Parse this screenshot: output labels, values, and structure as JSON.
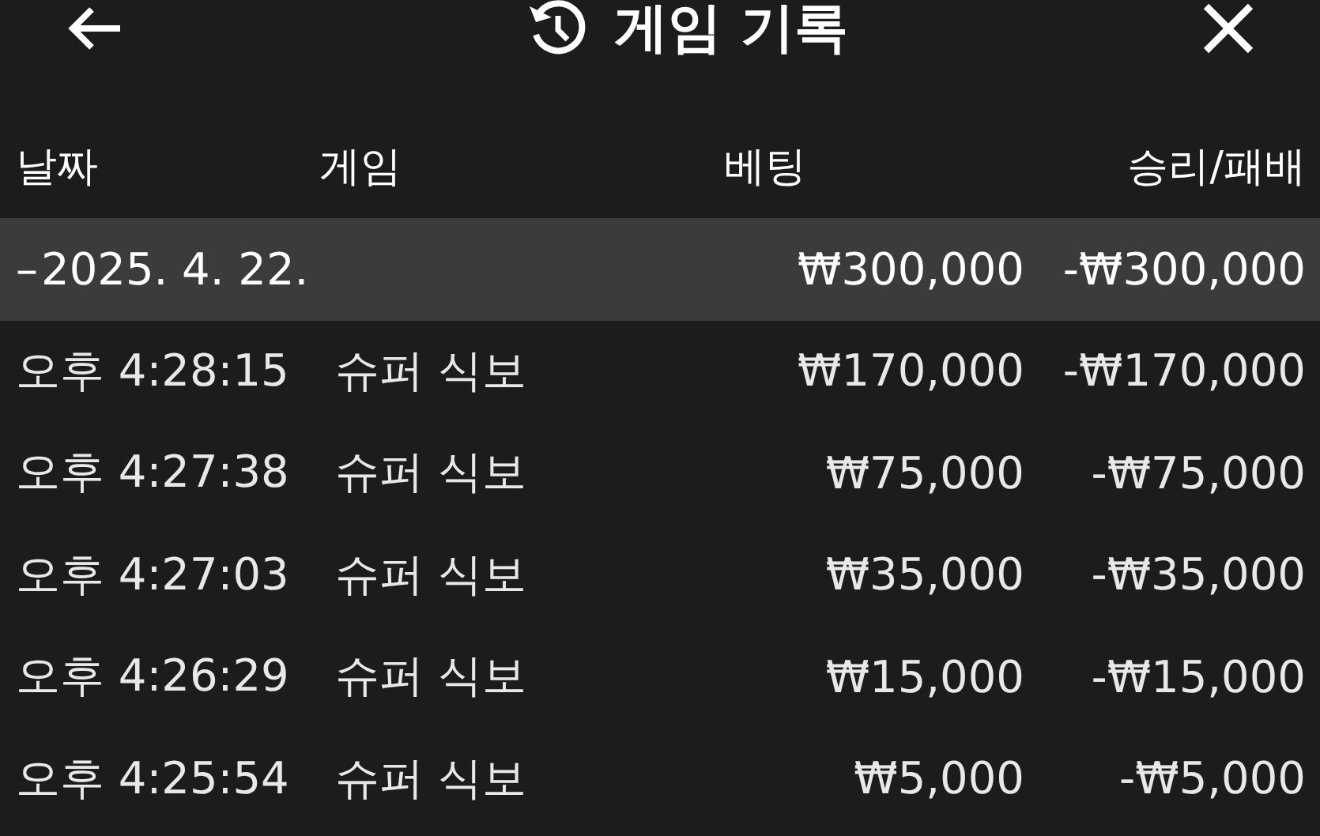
{
  "header": {
    "title": "게임 기록"
  },
  "columns": [
    "날짜",
    "게임",
    "베팅",
    "승리/패배"
  ],
  "groups": [
    {
      "toggle": "–",
      "date": "2025. 4. 22.",
      "bet": "₩300,000",
      "result": "-₩300,000",
      "expanded": true,
      "rows": [
        {
          "time": "오후 4:28:15",
          "game": "슈퍼 식보",
          "bet": "₩170,000",
          "result": "-₩170,000"
        },
        {
          "time": "오후 4:27:38",
          "game": "슈퍼 식보",
          "bet": "₩75,000",
          "result": "-₩75,000"
        },
        {
          "time": "오후 4:27:03",
          "game": "슈퍼 식보",
          "bet": "₩35,000",
          "result": "-₩35,000"
        },
        {
          "time": "오후 4:26:29",
          "game": "슈퍼 식보",
          "bet": "₩15,000",
          "result": "-₩15,000"
        },
        {
          "time": "오후 4:25:54",
          "game": "슈퍼 식보",
          "bet": "₩5,000",
          "result": "-₩5,000"
        }
      ]
    }
  ]
}
